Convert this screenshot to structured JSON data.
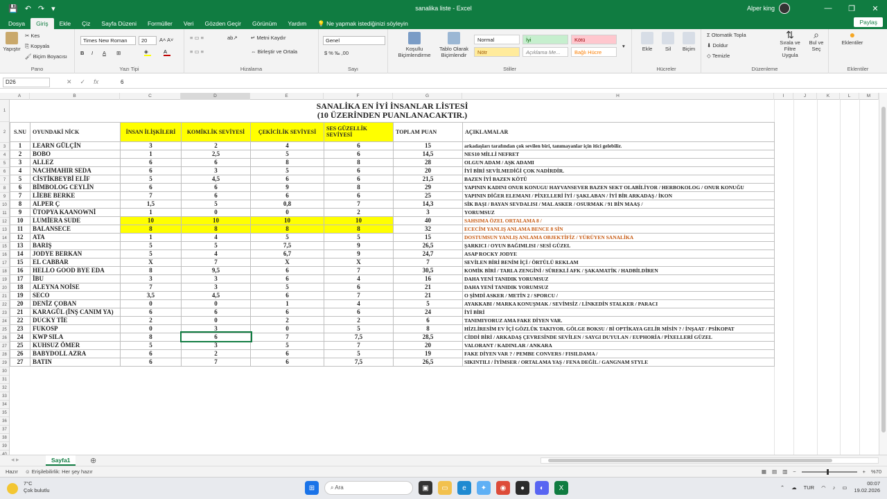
{
  "window": {
    "title": "sanalika liste  -  Excel",
    "user_name": "Alper king",
    "share_label": "Paylaş"
  },
  "tabs": [
    "Dosya",
    "Giriş",
    "Ekle",
    "Çiz",
    "Sayfa Düzeni",
    "Formüller",
    "Veri",
    "Gözden Geçir",
    "Görünüm",
    "Yardım",
    "Ne yapmak istediğinizi söyleyin"
  ],
  "ribbon": {
    "paste": "Yapıştır",
    "cut": "Kes",
    "copy": "Kopyala",
    "format_painter": "Biçim Boyacısı",
    "clipboard_group": "Pano",
    "font_name": "Times New Roman",
    "font_size": "20",
    "font_group": "Yazı Tipi",
    "wrap_text": "Metni Kaydır",
    "merge_center": "Birleştir ve Ortala",
    "alignment_group": "Hizalama",
    "number_format": "Genel",
    "number_group": "Sayı",
    "conditional_formatting": "Koşullu Biçimlendirme",
    "format_as_table": "Tablo Olarak Biçimlendir",
    "styles": [
      "Normal",
      "İyi",
      "Kötü",
      "Nötr",
      "Açıklama Me...",
      "Bağlı Hücre"
    ],
    "styles_group": "Stiller",
    "insert": "Ekle",
    "delete": "Sil",
    "format": "Biçim",
    "cells_group": "Hücreler",
    "autosum": "Otomatik Topla",
    "fill": "Doldur",
    "clear": "Temizle",
    "sort_filter": "Sırala ve Filtre Uygula",
    "find_select": "Bul ve Seç",
    "editing_group": "Düzenleme",
    "addins": "Eklentiler",
    "addins_group": "Eklentiler",
    "color_fill": "#ffff00",
    "color_font": "#c00000"
  },
  "formula_bar": {
    "cell_ref": "D26",
    "value": "6"
  },
  "columns": [
    "A",
    "B",
    "C",
    "D",
    "E",
    "F",
    "G",
    "H",
    "I",
    "J",
    "K",
    "L",
    "M"
  ],
  "rows": [
    "1",
    "2",
    "3",
    "4",
    "5",
    "6",
    "7",
    "8",
    "9",
    "10",
    "11",
    "12",
    "13",
    "14",
    "15",
    "16",
    "17",
    "18",
    "19",
    "20",
    "21",
    "22",
    "23",
    "24",
    "25",
    "26",
    "27",
    "28",
    "29",
    "30",
    "31",
    "32",
    "33",
    "34",
    "35",
    "36",
    "37",
    "38",
    "39",
    "40",
    "41"
  ],
  "sheet": {
    "title": "SANALİKA EN İYİ İNSANLAR LİSTESİ",
    "subtitle": "(10 ÜZERİNDEN PUANLANACAKTIR.)",
    "headers": [
      "S.NU",
      "OYUNDAKİ NİCK",
      "İNSAN İLİŞKİLERİ",
      "KOMİKLİK SEVİYESİ",
      "ÇEKİCİLİK SEVİYESİ",
      "SES GÜZELLİK SEVİYESİ",
      "TOPLAM PUAN",
      "AÇIKLAMALAR"
    ],
    "rows": [
      [
        "1",
        "LEARN GÜLÇİN",
        "3",
        "2",
        "4",
        "6",
        "15",
        "arkadaşları tarafından çok sevilen biri, tanımayanlar için itici gelebilir."
      ],
      [
        "2",
        "BOBO",
        "1",
        "2,5",
        "5",
        "6",
        "14,5",
        "NES10 MİLLİ NEFRET"
      ],
      [
        "3",
        "ALLEZ",
        "6",
        "6",
        "8",
        "8",
        "28",
        "OLGUN ADAM / AŞK ADAMI"
      ],
      [
        "4",
        "NACHMAHIR SEDA",
        "6",
        "3",
        "5",
        "6",
        "20",
        "İYİ BİRİ SEVİLMEDİĞİ ÇOK NADİRDİR."
      ],
      [
        "5",
        "CİSTİKBEYBİ ELİF",
        "5",
        "4,5",
        "6",
        "6",
        "21,5",
        "BAZEN İYİ BAZEN KÖTÜ"
      ],
      [
        "6",
        "BİMBOLOG CEYLİN",
        "6",
        "6",
        "9",
        "8",
        "29",
        "YAPININ KADINI ONUR KONUGU HAYVANSEVER BAZEN SEKT OLABİLİYOR / HERBOKOLOG / ONUR KONUĞU"
      ],
      [
        "7",
        "LİEBE BERKE",
        "7",
        "6",
        "6",
        "6",
        "25",
        "YAPININ DİĞER ELEMANI / PİXELLERİ İYİ / ŞAKLABAN / İYİ BİR ARKADAŞ / İKON"
      ],
      [
        "8",
        "ALPER Ç",
        "1,5",
        "5",
        "0,8",
        "7",
        "14,3",
        "SİK BAŞI / BAYAN SEVDALISI / MAL ASKER / OSURMAK / 91 BİN MAAŞ /"
      ],
      [
        "9",
        "ÜTOPYA KAANOWNİ",
        "1",
        "0",
        "0",
        "2",
        "3",
        "YORUMSUZ"
      ],
      [
        "10",
        "LUMİERA SUDE",
        "10",
        "10",
        "10",
        "10",
        "40",
        "SAHSIMA ÖZEL ORTALAMA 8 /"
      ],
      [
        "11",
        "BALANSECE",
        "8",
        "8",
        "8",
        "8",
        "32",
        "ECECİM YANLIŞ ANLAMA BENCE 8 SİN"
      ],
      [
        "12",
        "ATA",
        "1",
        "4",
        "5",
        "5",
        "15",
        "DOSTUMSUN YANLIŞ ANLAMA OBJEKTİFİZ / YÜRÜYEN SANALİKA"
      ],
      [
        "13",
        "BARIŞ",
        "5",
        "5",
        "7,5",
        "9",
        "26,5",
        "ŞARKICI / OYUN BAĞIMLISI / SESİ GÜZEL"
      ],
      [
        "14",
        "JODYE BERKAN",
        "5",
        "4",
        "6,7",
        "9",
        "24,7",
        "ASAP ROCKY JODYE"
      ],
      [
        "15",
        "EL CABBAR",
        "X",
        "7",
        "X",
        "X",
        "7",
        "SEVİLEN BİRİ BENİM İÇİ / ÖRTÜLÜ REKLAM"
      ],
      [
        "16",
        "HELLO GOOD BYE EDA",
        "8",
        "9,5",
        "6",
        "7",
        "30,5",
        "KOMİK BİRİ / TARLA ZENGİNİ / SÜREKLİ AFK / ŞAKAMATİK / HADBİLDİREN"
      ],
      [
        "17",
        "İBU",
        "3",
        "3",
        "6",
        "4",
        "16",
        "DAHA YENİ TANIDIK YORUMSUZ"
      ],
      [
        "18",
        "ALEYNA NOİSE",
        "7",
        "3",
        "5",
        "6",
        "21",
        "DAHA YENİ TANIDIK YORUMSUZ"
      ],
      [
        "19",
        "SECO",
        "3,5",
        "4,5",
        "6",
        "7",
        "21",
        "O ŞİMDİ ASKER / METİN 2 / SPORCU /"
      ],
      [
        "20",
        "DENİZ ÇOBAN",
        "0",
        "0",
        "1",
        "4",
        "5",
        "AYAKKABI / MARKA KONUŞMAK / SEVİMSİZ / LİNKEDİN STALKER / PARACI"
      ],
      [
        "21",
        "KARAGÜL (İNŞ CANIM YA)",
        "6",
        "6",
        "6",
        "6",
        "24",
        "İYİ BİRİ"
      ],
      [
        "22",
        "DUCKY TİE",
        "2",
        "0",
        "2",
        "2",
        "6",
        "TANIMIYORUZ AMA FAKE DİYEN VAR."
      ],
      [
        "23",
        "FUKOSP",
        "0",
        "3",
        "0",
        "5",
        "8",
        "HİZLİRESİM EV İÇİ GÖZLÜK TAKIYOR. GÖLGE BOKSU / Bİ OPTİKAYA GELİR MİSİN ? / İNŞAAT / PSİKOPAT"
      ],
      [
        "24",
        "KWP SILA",
        "8",
        "6",
        "7",
        "7,5",
        "28,5",
        "CİDDİ BİRİ / ARKADAŞ ÇEVRESİNDE SEVİLEN / SAYGI DUYULAN / EUPHORİA / PİXELLERİ GÜZEL"
      ],
      [
        "25",
        "KUHSUZ ÖMER",
        "5",
        "3",
        "5",
        "7",
        "20",
        "VALORANT / KADINLAR / ANKARA"
      ],
      [
        "26",
        "BABYDOLL AZRA",
        "6",
        "2",
        "6",
        "5",
        "19",
        "FAKE DİYEN VAR ? / PEMBE CONVERS / FISILDAMA /"
      ],
      [
        "27",
        "BATIN",
        "6",
        "7",
        "6",
        "7,5",
        "26,5",
        "SIKINTILI / İYİMSER / ORTALAMA YAŞ / FENA DEĞİL / GANGNAM STYLE"
      ]
    ]
  },
  "sheet_tab": "Sayfa1",
  "status": {
    "ready": "Hazır",
    "accessibility": "Erişilebilirlik: Her şey hazır",
    "zoom": "%70"
  },
  "taskbar": {
    "temp": "7°C",
    "weather": "Çok bulutlu",
    "search_placeholder": "Ara",
    "lang": "TUR",
    "time": "00:07",
    "date": "19.02.2026"
  }
}
